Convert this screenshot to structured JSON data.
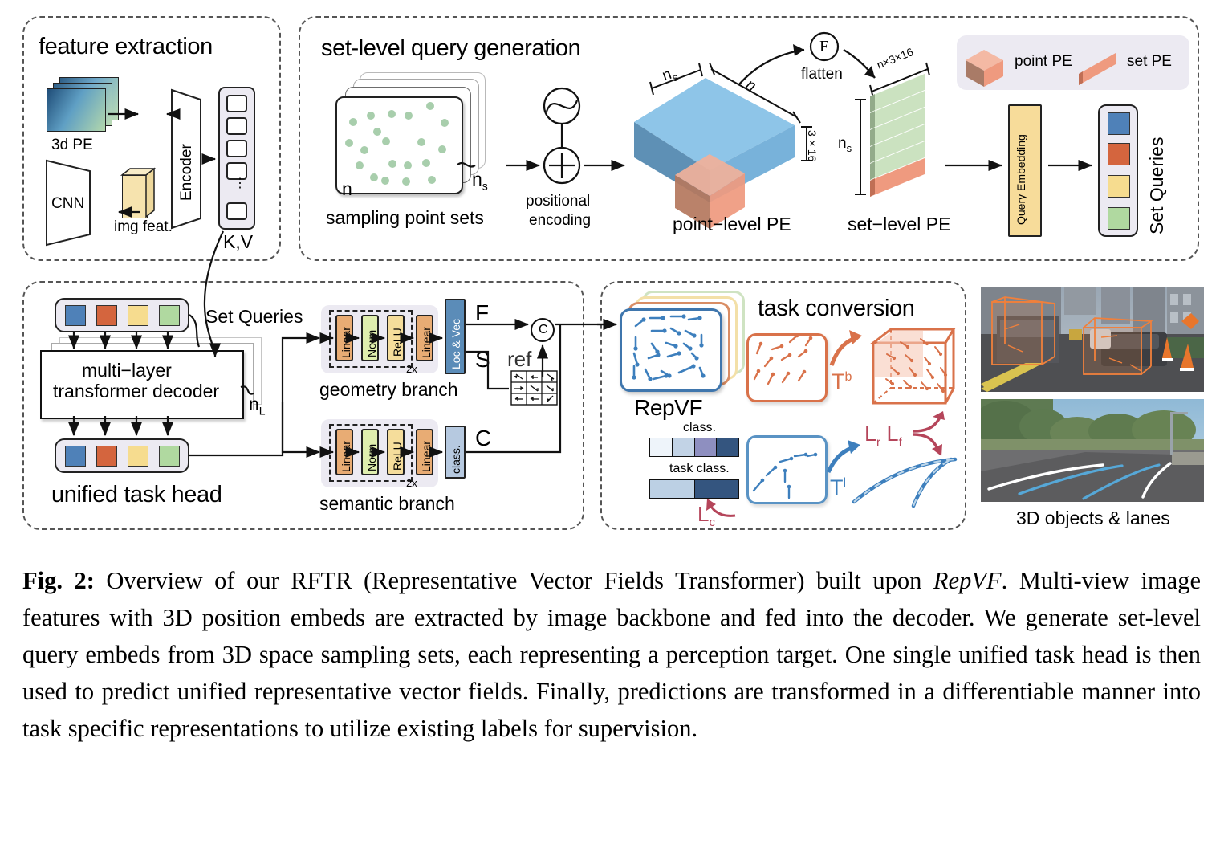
{
  "figure": {
    "panels": {
      "feature_extraction": {
        "title": "feature extraction",
        "labels": {
          "pe": "3d PE",
          "cnn": "CNN",
          "img_feat": "img feat.",
          "encoder": "Encoder",
          "kv": "K,V"
        }
      },
      "set_level_query_generation": {
        "title": "set-level query generation",
        "labels": {
          "sampling": "sampling point sets",
          "n": "n",
          "ns": "n",
          "ns_sub": "s",
          "positional": "positional",
          "encoding": "encoding",
          "flatten": "flatten",
          "flatten_icon": "F",
          "cube_ns": "n",
          "cube_ns_sub": "s",
          "cube_n": "n",
          "cube_depth": "3×16",
          "point_level_pe": "point−level PE",
          "set_level_pe": "set−level PE",
          "slab_top": "n×3×16",
          "slab_side": "n",
          "slab_side_sub": "s",
          "query_embedding": "Query Embedding",
          "set_queries": "Set Queries"
        },
        "legend": [
          {
            "name": "point PE",
            "shape": "cube",
            "color": "#efa08a"
          },
          {
            "name": "set PE",
            "shape": "slab",
            "color": "#ef9a82"
          }
        ]
      },
      "unified_task_head": {
        "title": "unified task head",
        "labels": {
          "set_queries": "Set Queries",
          "decoder": [
            "multi−layer",
            "transformer decoder"
          ],
          "nl": "n",
          "nl_sub": "L",
          "geometry_branch": "geometry branch",
          "semantic_branch": "semantic branch",
          "repeat": "2x",
          "loc_vec": "Loc & Vec",
          "class": "class.",
          "F": "F",
          "S": "S",
          "C": "C",
          "ref": "ref",
          "concat": "C"
        },
        "mlp_blocks": [
          "Linear",
          "Norm",
          "ReLU",
          "Linear"
        ]
      },
      "task_conversion": {
        "title": "task conversion",
        "labels": {
          "repvf": "RepVF",
          "class": "class.",
          "task_class": "task class.",
          "Lc": "L",
          "Lc_sub": "c",
          "Tb": "T",
          "Tb_sup": "b",
          "Tl": "T",
          "Tl_sup": "l",
          "Lr": "L",
          "Lr_sub": "r",
          "Lf": "L",
          "Lf_sub": "f"
        },
        "class_bar": [
          "#eef4fa",
          "#c2d3e6",
          "#8e8fc0",
          "#34557f"
        ],
        "task_class_bar": [
          "#bcd0e4",
          "#34557f"
        ]
      },
      "results": {
        "caption": "3D objects & lanes"
      }
    },
    "colors": {
      "query_blue": "#4f81b8",
      "query_orange": "#d4653e",
      "query_yellow": "#f6dc8f",
      "query_green": "#b0d9a0",
      "cube_blue": "#8ec5e8",
      "cube_blue_dark": "#5e90b5",
      "pe_orange": "#ef9a7f",
      "slab_green": "#cbe2c0",
      "linear": "#e8ac74",
      "norm": "#dfeeae",
      "relu": "#f5dd9b",
      "locvec": "#5b8cb8",
      "classbox": "#b6c9e0",
      "loss_red": "#b5455a",
      "lane_blue": "#56a8d8",
      "box_orange": "#e8762c"
    }
  },
  "caption": {
    "prefix": "Fig. 2:",
    "lead": " Overview of our RFTR (Representative Vector Fields Transformer) built upon ",
    "emph": "RepVF",
    "body": ". Multi-view image features with 3D position embeds are extracted by image backbone and fed into the decoder. We generate set-level query embeds from 3D space sampling sets, each representing a perception target. One single unified task head is then used to predict unified representative vector fields. Finally, predictions are transformed in a differentiable manner into task specific representations to utilize existing labels for supervision."
  }
}
